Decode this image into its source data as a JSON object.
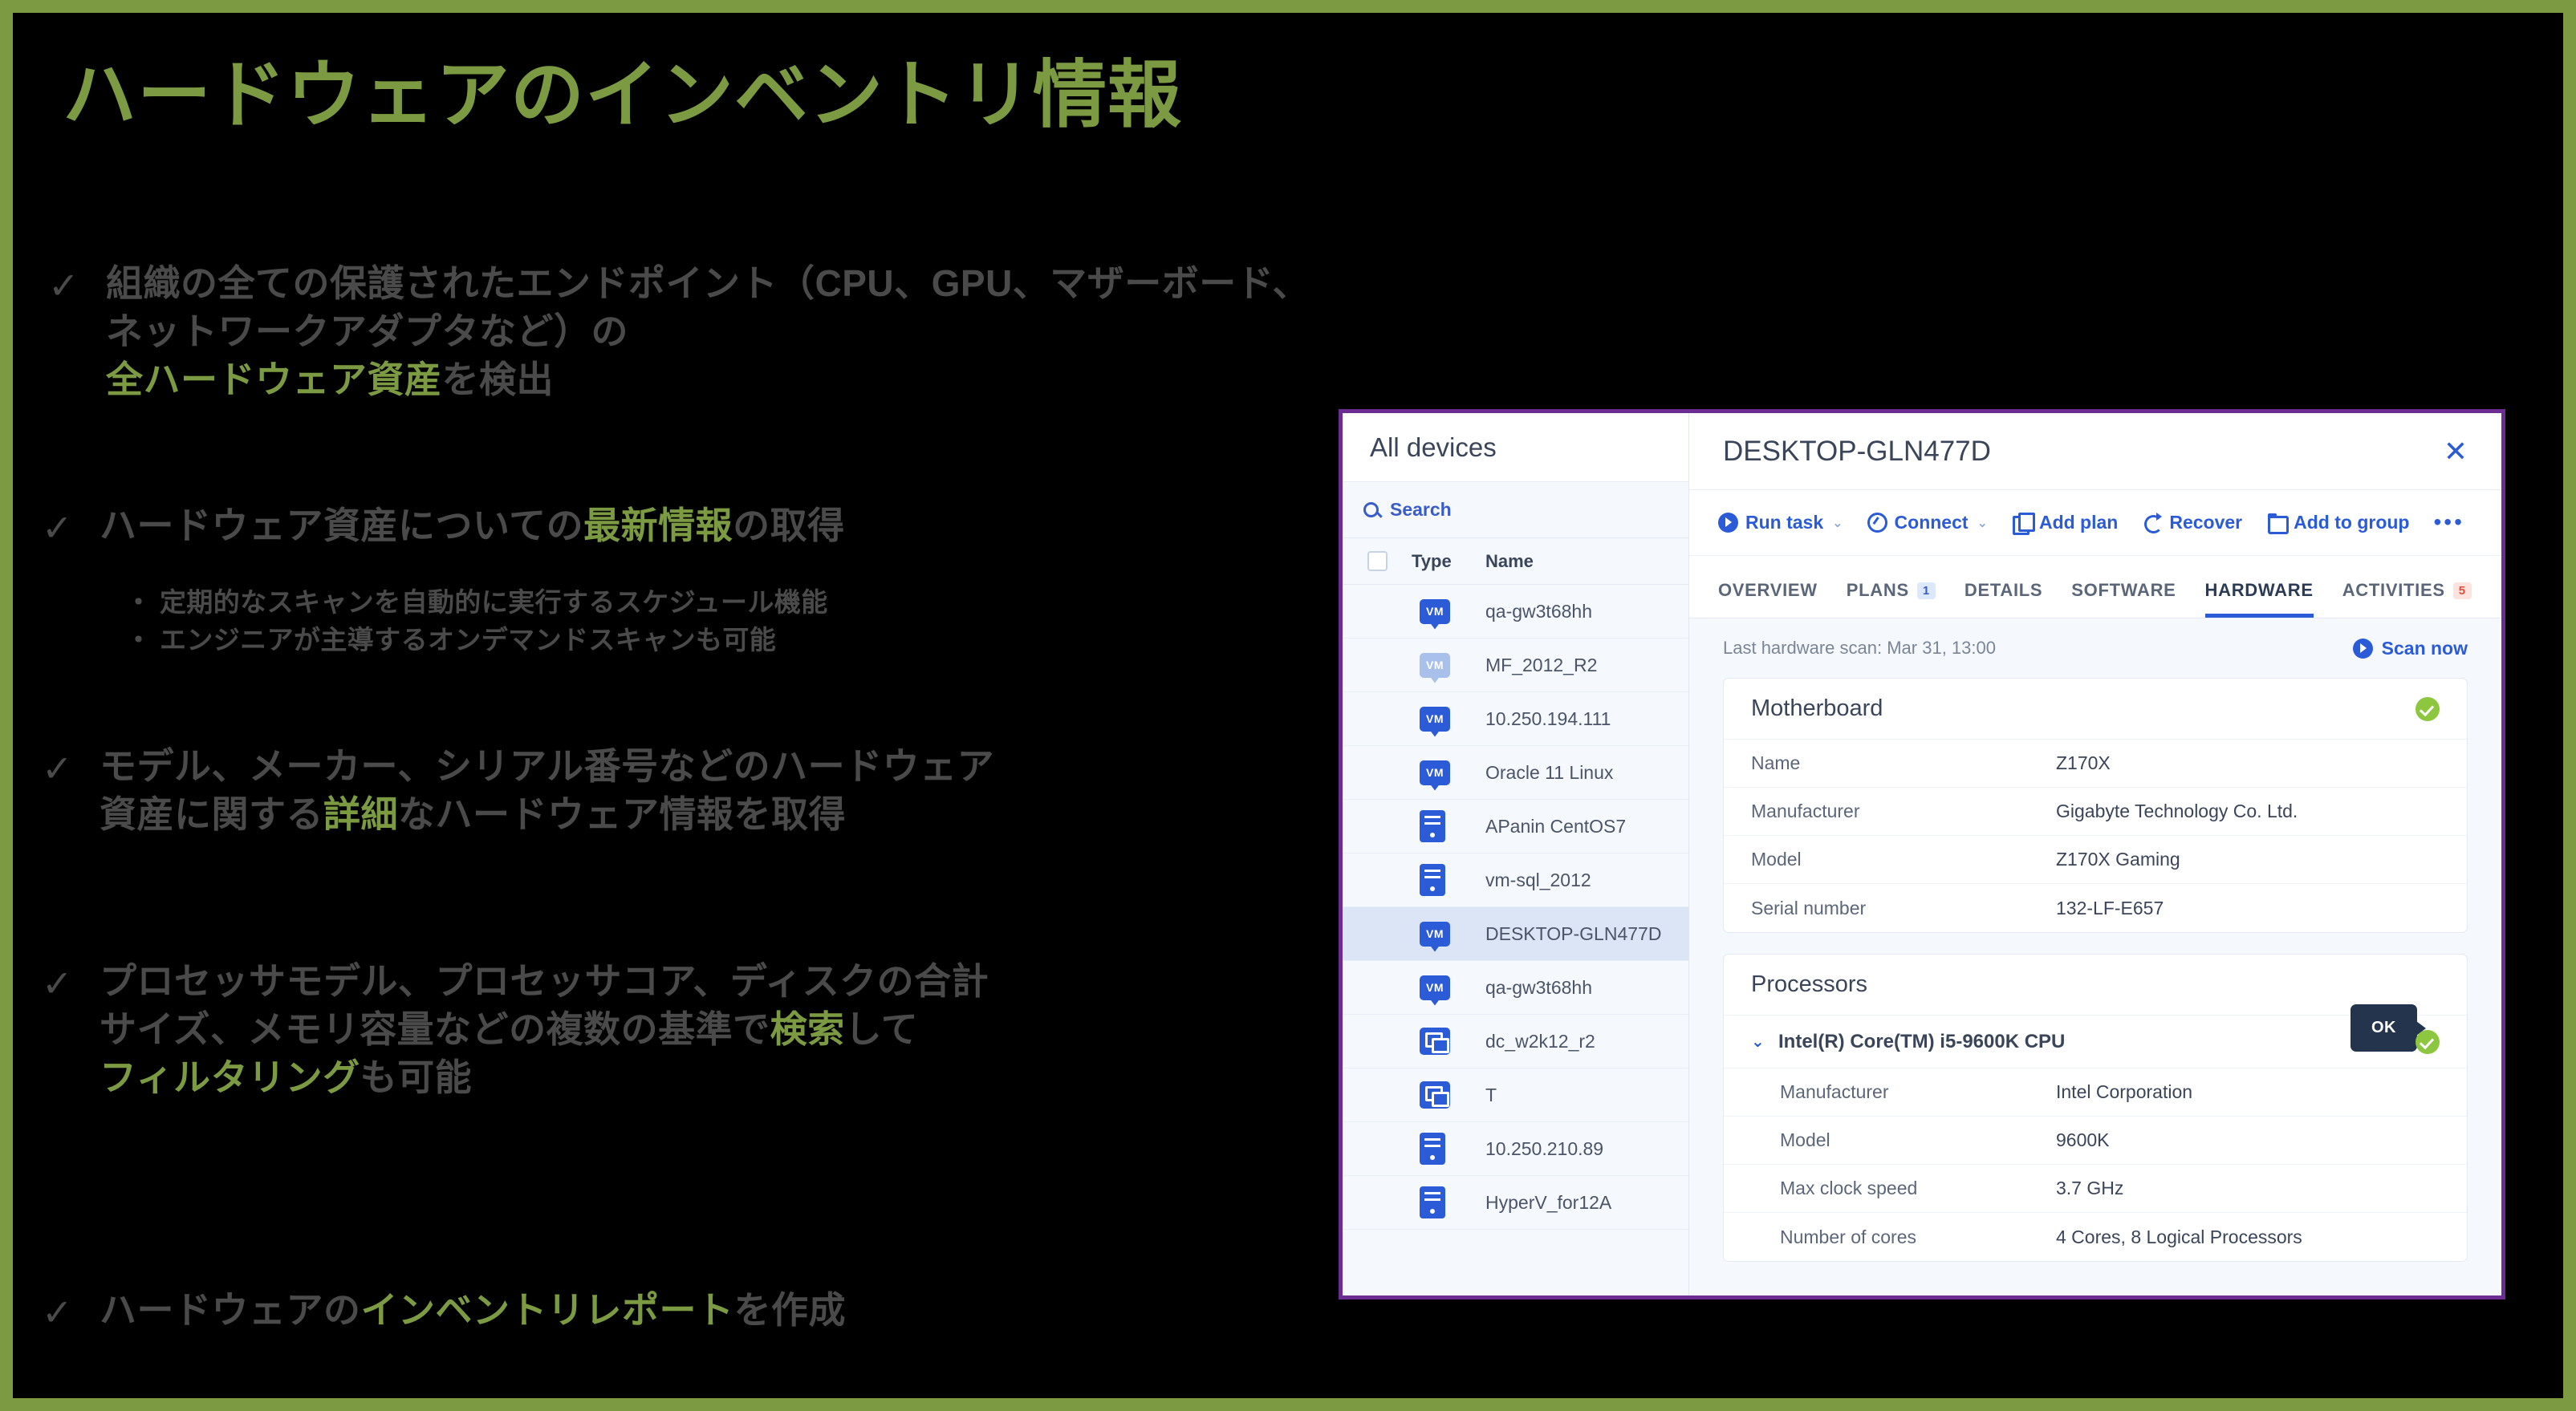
{
  "slide": {
    "title": "ハードウェアのインベントリ情報",
    "border_color": "#7b9a42",
    "accent_color": "#7b9a42",
    "text_color": "#4a4a4a",
    "background_color": "#000000",
    "check_glyph": "✓",
    "bullets": [
      {
        "line1_plain": "組織の全ての保護されたエンドポイント（CPU、GPU、マザーボード、ネットワークアダプタなど）の",
        "line2_highlight": "全ハードウェア資産",
        "line2_plain": "を検出"
      },
      {
        "pre": "ハードウェア資産についての",
        "highlight": "最新情報",
        "post": "の取得",
        "subs": [
          "・ 定期的なスキャンを自動的に実行するスケジュール機能",
          "・ エンジニアが主導するオンデマンドスキャンも可能"
        ]
      },
      {
        "line1": "モデル、メーカー、シリアル番号などのハードウェア",
        "line2_pre": "資産に関する",
        "line2_highlight": "詳細",
        "line2_post": "なハードウェア情報を取得"
      },
      {
        "line1": "プロセッサモデル、プロセッサコア、ディスクの合計",
        "line2_pre": "サイズ、メモリ容量などの複数の基準で",
        "line2_highlight": "検索",
        "line2_post": "して",
        "line3_highlight": "フィルタリング",
        "line3_post": "も可能"
      },
      {
        "pre": "ハードウェアの",
        "highlight": "インベントリレポート",
        "post": "を作成"
      }
    ]
  },
  "screenshot": {
    "border_color": "#6b2d91",
    "devices": {
      "title": "All devices",
      "search_placeholder": "Search",
      "columns": [
        "Type",
        "Name"
      ],
      "rows": [
        {
          "name": "qa-gw3t68hh",
          "icon": "vm-icon",
          "selected": false,
          "dim": false
        },
        {
          "name": "MF_2012_R2",
          "icon": "vm-icon",
          "selected": false,
          "dim": true
        },
        {
          "name": "10.250.194.111",
          "icon": "vm-icon",
          "selected": false,
          "dim": false
        },
        {
          "name": "Oracle 11 Linux",
          "icon": "vm-icon",
          "selected": false,
          "dim": false
        },
        {
          "name": "APanin CentOS7",
          "icon": "server-icon",
          "selected": false,
          "dim": false
        },
        {
          "name": "vm-sql_2012",
          "icon": "server-icon",
          "selected": false,
          "dim": false
        },
        {
          "name": "DESKTOP-GLN477D",
          "icon": "vm-icon",
          "selected": true,
          "dim": false
        },
        {
          "name": "qa-gw3t68hh",
          "icon": "vm-icon",
          "selected": false,
          "dim": false
        },
        {
          "name": "dc_w2k12_r2",
          "icon": "cluster-icon",
          "selected": false,
          "dim": false
        },
        {
          "name": "T",
          "icon": "cluster-icon",
          "selected": false,
          "dim": false
        },
        {
          "name": "10.250.210.89",
          "icon": "server-icon",
          "selected": false,
          "dim": false
        },
        {
          "name": "HyperV_for12A",
          "icon": "server-icon",
          "selected": false,
          "dim": false
        }
      ]
    },
    "detail": {
      "title": "DESKTOP-GLN477D",
      "close_label": "✕",
      "toolbar": [
        {
          "label": "Run task",
          "icon": "play-icon",
          "caret": true
        },
        {
          "label": "Connect",
          "icon": "connect-icon",
          "caret": true
        },
        {
          "label": "Add plan",
          "icon": "plan-icon",
          "caret": false
        },
        {
          "label": "Recover",
          "icon": "recover-icon",
          "caret": false
        },
        {
          "label": "Add to group",
          "icon": "group-icon",
          "caret": false
        }
      ],
      "more_label": "•••",
      "tabs": [
        {
          "label": "OVERVIEW",
          "badge": "",
          "active": false
        },
        {
          "label": "PLANS",
          "badge": "1",
          "active": false
        },
        {
          "label": "DETAILS",
          "badge": "",
          "active": false
        },
        {
          "label": "SOFTWARE",
          "badge": "",
          "active": false
        },
        {
          "label": "HARDWARE",
          "badge": "",
          "active": true
        },
        {
          "label": "ACTIVITIES",
          "badge": "5",
          "active": false
        }
      ],
      "scan_text": "Last hardware scan: Mar 31, 13:00",
      "scan_button": "Scan now",
      "motherboard": {
        "title": "Motherboard",
        "rows": [
          {
            "key": "Name",
            "value": "Z170X"
          },
          {
            "key": "Manufacturer",
            "value": "Gigabyte Technology Co. Ltd."
          },
          {
            "key": "Model",
            "value": "Z170X Gaming"
          },
          {
            "key": "Serial number",
            "value": "132-LF-E657"
          }
        ]
      },
      "processors": {
        "title": "Processors",
        "cpu_label": "Intel(R) Core(TM) i5-9600K CPU",
        "tooltip": "OK",
        "rows": [
          {
            "key": "Manufacturer",
            "value": "Intel Corporation"
          },
          {
            "key": "Model",
            "value": "9600K"
          },
          {
            "key": "Max clock speed",
            "value": "3.7 GHz"
          },
          {
            "key": "Number of  cores",
            "value": "4 Cores, 8 Logical Processors"
          }
        ]
      }
    }
  }
}
